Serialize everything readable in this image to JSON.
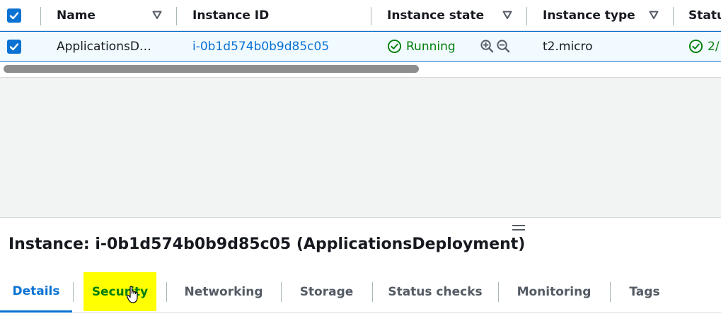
{
  "table": {
    "headers": {
      "name": "Name",
      "instance_id": "Instance ID",
      "instance_state": "Instance state",
      "instance_type": "Instance type",
      "status": "Statu"
    },
    "row": {
      "name": "ApplicationsD…",
      "instance_id": "i-0b1d574b0b9d85c05",
      "state": "Running",
      "type": "t2.micro",
      "status": "2/"
    }
  },
  "panel": {
    "title": "Instance: i-0b1d574b0b9d85c05 (ApplicationsDeployment)",
    "tabs": [
      "Details",
      "Security",
      "Networking",
      "Storage",
      "Status checks",
      "Monitoring",
      "Tags"
    ]
  },
  "colors": {
    "accent": "#0972d3",
    "success": "#037f0c",
    "highlight": "#ffff00"
  }
}
